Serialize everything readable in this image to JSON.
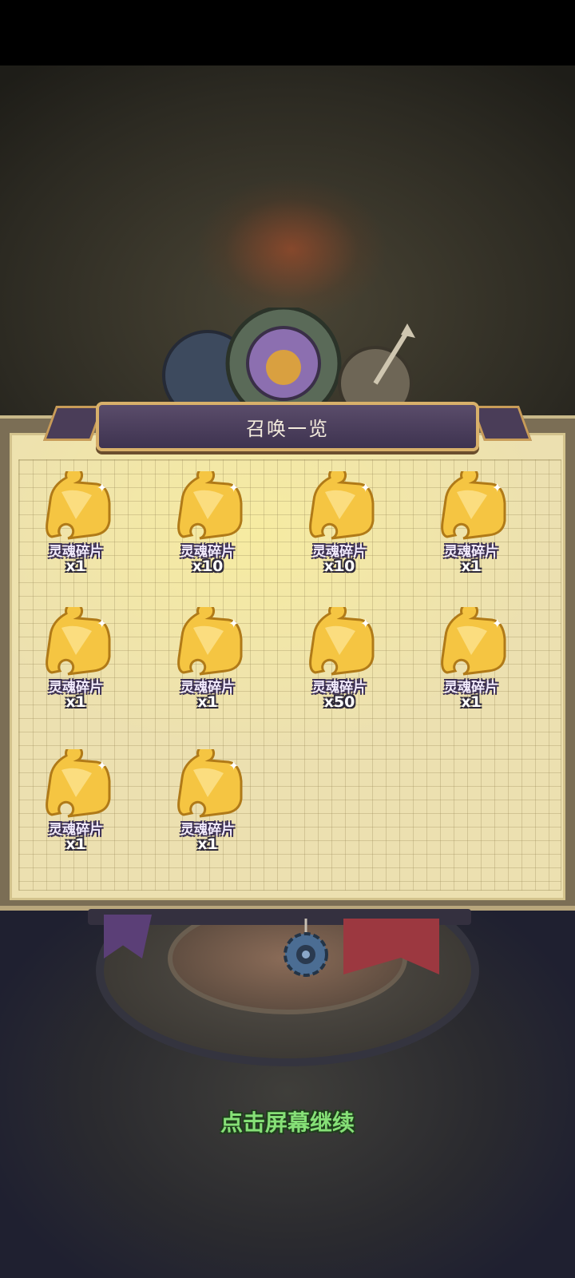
{
  "dialog": {
    "title": "召唤一览"
  },
  "rewards": [
    {
      "name": "灵魂碎片",
      "quantity": "x1",
      "icon": "puzzle-piece-icon"
    },
    {
      "name": "灵魂碎片",
      "quantity": "x10",
      "icon": "puzzle-piece-icon"
    },
    {
      "name": "灵魂碎片",
      "quantity": "x10",
      "icon": "puzzle-piece-icon"
    },
    {
      "name": "灵魂碎片",
      "quantity": "x1",
      "icon": "puzzle-piece-icon"
    },
    {
      "name": "灵魂碎片",
      "quantity": "x1",
      "icon": "puzzle-piece-icon"
    },
    {
      "name": "灵魂碎片",
      "quantity": "x1",
      "icon": "puzzle-piece-icon"
    },
    {
      "name": "灵魂碎片",
      "quantity": "x50",
      "icon": "puzzle-piece-icon"
    },
    {
      "name": "灵魂碎片",
      "quantity": "x1",
      "icon": "puzzle-piece-icon"
    },
    {
      "name": "灵魂碎片",
      "quantity": "x1",
      "icon": "puzzle-piece-icon"
    },
    {
      "name": "灵魂碎片",
      "quantity": "x1",
      "icon": "puzzle-piece-icon"
    }
  ],
  "footer": {
    "continue_prompt": "点击屏幕继续"
  },
  "colors": {
    "continue_text": "#86e077",
    "banner": "#4a3d5c",
    "puzzle_gold": "#f5c542"
  }
}
